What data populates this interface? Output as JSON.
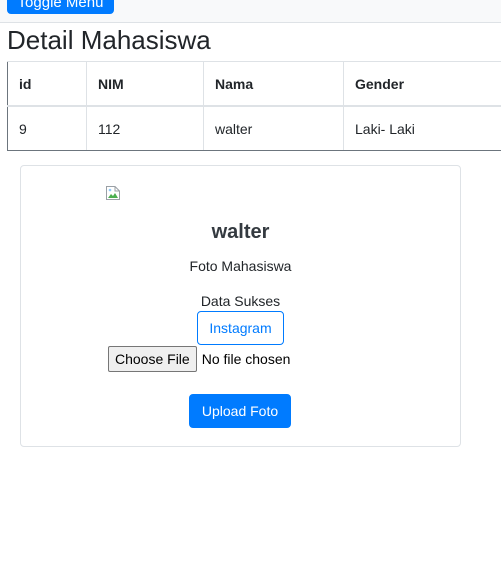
{
  "topbar": {
    "toggle_label": "Toggle Menu"
  },
  "page_title": "Detail Mahasiswa",
  "table": {
    "headers": [
      "id",
      "NIM",
      "Nama",
      "Gender"
    ],
    "rows": [
      [
        "9",
        "112",
        "walter",
        "Laki- Laki"
      ]
    ]
  },
  "card": {
    "name": "walter",
    "caption": "Foto Mahasiswa",
    "status": "Data Sukses",
    "instagram_label": "Instagram",
    "file_button_label": "Choose File",
    "file_status": "No file chosen",
    "upload_label": "Upload Foto"
  },
  "icons": {
    "broken_image": "broken-image-icon"
  },
  "colors": {
    "primary": "#007bff",
    "border": "#dee2e6"
  }
}
